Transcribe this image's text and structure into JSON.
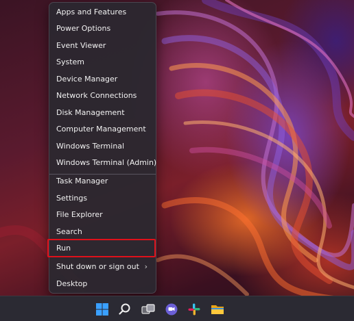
{
  "menu": {
    "items": [
      {
        "label": "Apps and Features"
      },
      {
        "label": "Power Options"
      },
      {
        "label": "Event Viewer"
      },
      {
        "label": "System"
      },
      {
        "label": "Device Manager"
      },
      {
        "label": "Network Connections"
      },
      {
        "label": "Disk Management"
      },
      {
        "label": "Computer Management"
      },
      {
        "label": "Windows Terminal"
      },
      {
        "label": "Windows Terminal (Admin)"
      },
      {
        "label": "Task Manager"
      },
      {
        "label": "Settings"
      },
      {
        "label": "File Explorer"
      },
      {
        "label": "Search"
      },
      {
        "label": "Run"
      },
      {
        "label": "Shut down or sign out"
      },
      {
        "label": "Desktop"
      }
    ],
    "submenu_indicator": "›"
  },
  "highlight_color": "#e0101a",
  "taskbar": {
    "icons": [
      "windows-start-icon",
      "search-icon",
      "task-view-icon",
      "teams-chat-icon",
      "slack-icon",
      "file-explorer-icon"
    ]
  }
}
